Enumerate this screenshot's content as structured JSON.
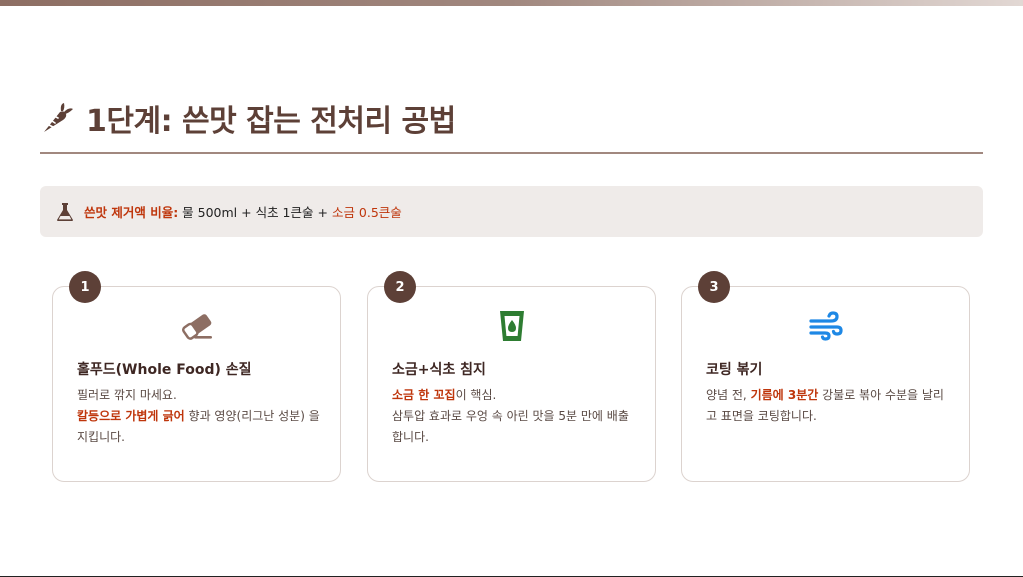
{
  "header": {
    "title": "1단계: 쓴맛 잡는 전처리 공법",
    "icon": "carrot-icon"
  },
  "notice": {
    "icon": "flask-icon",
    "label": "쓴맛 제거액 비율:",
    "text": " 물 500ml + 식초 1큰술 + ",
    "tail": "소금 0.5큰술"
  },
  "steps": [
    {
      "number": "1",
      "icon": "eraser-icon",
      "icon_color": "#8d6e63",
      "title": "홀푸드(Whole Food) 손질",
      "line1": "필러로 깎지 마세요.",
      "highlight": "칼등으로 가볍게 긁어",
      "rest": " 향과 영양(리그난 성분) 을 지킵니다."
    },
    {
      "number": "2",
      "icon": "glass-water-icon",
      "icon_color": "#2e7d32",
      "title": "소금+식초 침지",
      "highlight": "소금 한 꼬집",
      "rest": "이 핵심.",
      "line2": "삼투압 효과로 우엉 속 아린 맛을 5분 만에 배출합니다."
    },
    {
      "number": "3",
      "icon": "wind-icon",
      "icon_color": "#1e88e5",
      "title": "코팅 볶기",
      "pre": "양념 전, ",
      "highlight": "기름에 3분간",
      "rest": " 강불로 볶아 수분을 날리고 표면을 코팅합니다."
    }
  ],
  "colors": {
    "accent": "#5d4037",
    "highlight": "#bf360c",
    "notice_bg": "#efebe9"
  }
}
